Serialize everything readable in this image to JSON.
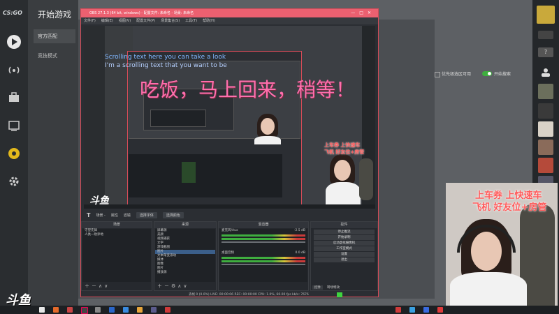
{
  "csgo": {
    "logo": "CS:GO",
    "title": "开始游戏",
    "tabs": [
      "官方匹配",
      "竞技模式"
    ],
    "queue_label": "优先级选区可用",
    "start_label": "开始搜索"
  },
  "obs": {
    "title": "OBS 27.1.3 (64 bit, windows) - 配置文件: 未命名 - 场景: 未命名",
    "menu": [
      "文件(F)",
      "编辑(E)",
      "视图(V)",
      "配置文件(P)",
      "场景集合(S)",
      "工具(T)",
      "帮助(H)"
    ],
    "overlay_text": "吃饭，马上回来，稍等！",
    "scroll_text_1": "Scrolling text here you can take a look",
    "scroll_text_2": "I'm a scrolling text that you want to be",
    "cam_text_1": "上车券  上快速车",
    "cam_text_2": "飞机  好友位+房管",
    "toolbar": {
      "source_label": "场景 -",
      "props": "属性",
      "filters": "滤镜",
      "btn1": "选择字体",
      "btn2": "选择颜色"
    },
    "docks": {
      "scenes": "场景",
      "sources": "来源",
      "mixer": "混音器",
      "controls": "控件"
    },
    "scene_items": [
      "守望先锋",
      "人类一败涂地"
    ],
    "source_items": [
      "屏幕源",
      "美颜",
      "视频捕获",
      "文字",
      "游戏截图",
      "图片",
      "文本渐变滚动",
      "媒体",
      "图像",
      "图片",
      "播放源"
    ],
    "mixer_items": [
      {
        "name": "麦克风/Aux",
        "db": "-2.5 dB"
      },
      {
        "name": "桌面音频",
        "db": "0.0 dB"
      }
    ],
    "control_buttons": [
      "停止推流",
      "开始录制",
      "启动虚拟摄像机",
      "工作室模式",
      "设置",
      "退出"
    ],
    "bottom_tabs": [
      "控件",
      "转场特效"
    ],
    "status": "丢帧 0 (0.0%)   LIVE: 00:00:06   REC: 00:00:00   CPU: 1.0%, 60.00 fps   kb/s: 7676"
  },
  "webcam": {
    "line1": "上车券  上快速车",
    "line2": "飞机  好友位+房管"
  },
  "brand": "斗鱼",
  "colors": {
    "obs_title": "#ec6070",
    "overlay_pink": "#ff6fae",
    "toggle_green": "#3fae3f"
  }
}
